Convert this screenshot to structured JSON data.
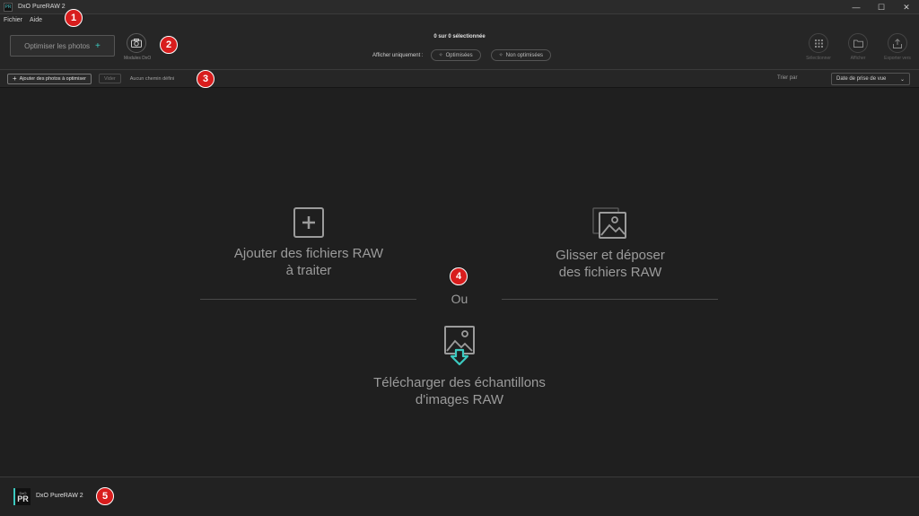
{
  "window": {
    "title": "DxO PureRAW 2",
    "app_icon_text": "PR",
    "controls": {
      "minimize": "—",
      "maximize": "☐",
      "close": "✕"
    }
  },
  "menu": [
    "Fichier",
    "Aide"
  ],
  "toolbar": {
    "optimize_label": "Optimiser les photos",
    "optimize_plus": "+",
    "modules_label": "Modules DxO",
    "selection_count": "0 sur 0 sélectionnée",
    "filter_label": "Afficher uniquement :",
    "filter_optimized": "Optimisées",
    "filter_not_optimized": "Non optimisées",
    "actions": [
      {
        "label": "Sélectionner",
        "icon": "grid-icon"
      },
      {
        "label": "Afficher",
        "icon": "folder-icon"
      },
      {
        "label": "Exporter vers",
        "icon": "export-icon"
      }
    ]
  },
  "subbar": {
    "add_photos_label": "Ajouter des photos à optimiser",
    "clear_label": "Vider",
    "path_label": "Aucun chemin défini",
    "sort_label": "Trier par",
    "sort_value": "Date de prise de vue"
  },
  "main": {
    "add_files_line1": "Ajouter des fichiers RAW",
    "add_files_line2": "à traiter",
    "drag_drop_line1": "Glisser et déposer",
    "drag_drop_line2": "des fichiers RAW",
    "or_text": "Ou",
    "download_line1": "Télécharger des échantillons",
    "download_line2": "d'images RAW"
  },
  "footer": {
    "logo_top": "DxO",
    "logo_main": "PR",
    "app_name": "DxO PureRAW 2"
  },
  "badges": [
    "1",
    "2",
    "3",
    "4",
    "5"
  ],
  "colors": {
    "accent": "#3ccac0",
    "badge": "#d81d1d",
    "background": "#1f1f1f"
  }
}
